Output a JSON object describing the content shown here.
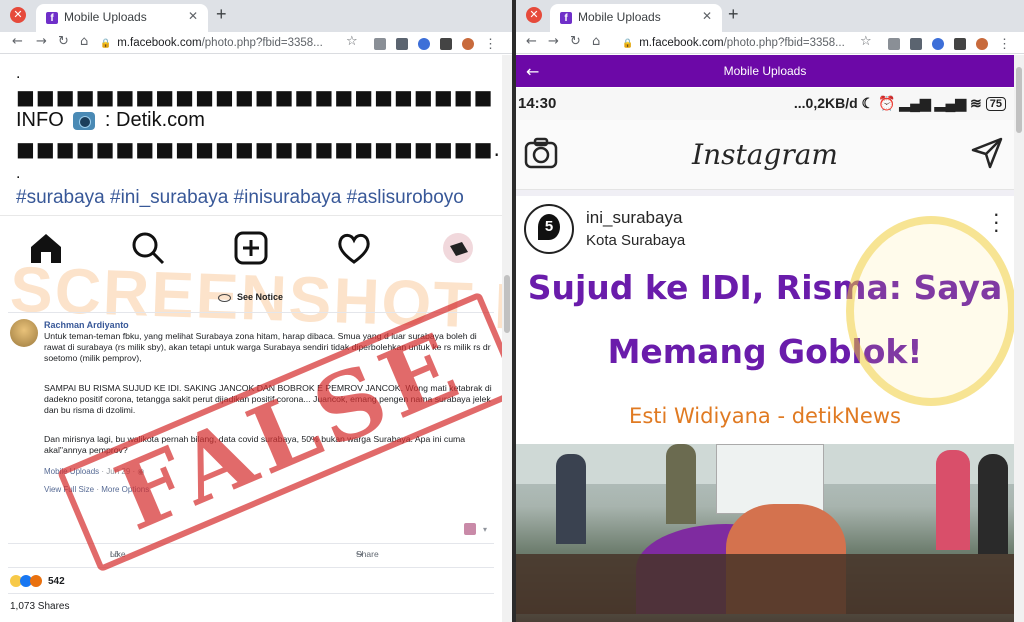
{
  "left_window": {
    "tab_title": "Mobile Uploads",
    "url_domain": "m.facebook.com",
    "url_path": "/photo.php?fbid=3358...",
    "post_image": {
      "dot1": ".",
      "blocks1": "■■■■■■■■■■■■■■■■■■■■■■■■",
      "info_prefix": "INFO",
      "info_suffix": ": Detik.com",
      "blocks2": "■■■■■■■■■■■■■■■■■■■■■■■■.",
      "dot2": ".",
      "hashtags": "#surabaya #ini_surabaya #inisurabaya #aslisuroboyo"
    },
    "see_notice": "See Notice",
    "comment": {
      "author": "Rachman Ardiyanto",
      "para1": "Untuk teman-teman fbku, yang melihat Surabaya zona hitam, harap dibaca. Smua yang d luar surabaya boleh di rawat di surabaya (rs milik sby), akan tetapi untuk warga Surabaya sendiri tidak diperbolehkan untuk ke rs milik rs dr soetomo (milik pemprov),",
      "para2": "SAMPAI BU RISMA SUJUD KE IDI. SAKING JANCOK DAN BOBROK E PEMROV JANCOK. Wong mati ketabrak di dadekno positif corona, tetangga sakit perut dijadikan positif corona... Juancok, emang pengen nama surabaya jelek dan bu risma di dzolimi.",
      "para3": "Dan mirisnya lagi, bu walikota pernah bilang, data covid surabaya, 50% bukan warga Surabaya. Apa ini cuma akal\"annya pemprov?",
      "album": "Mobile Uploads",
      "date": "Jun 29",
      "view_full": "View Full Size",
      "more_options": "More Options"
    },
    "like_label": "Like",
    "share_label": "Share",
    "reaction_count": "542",
    "shares_text": "1,073 Shares",
    "overlay": {
      "stamp": "FALSE",
      "watermark": "SCREENSHOT BY"
    }
  },
  "right_window": {
    "tab_title": "Mobile Uploads",
    "url_domain": "m.facebook.com",
    "url_path": "/photo.php?fbid=3358...",
    "header_title": "Mobile Uploads",
    "phone": {
      "time": "14:30",
      "status_right": "...0,2KB/d",
      "battery": "75",
      "ig_logo": "Instagram",
      "username": "ini_surabaya",
      "location": "Kota Surabaya",
      "headline1": "Sujud ke IDI, Risma: Saya",
      "headline2": "Memang Goblok!",
      "byline": "Esti Widiyana - detikNews"
    }
  },
  "colors": {
    "fb_purple": "#6c08a7",
    "headline_purple": "#6a1cab",
    "byline_orange": "#e07a22",
    "stamp_red": "#d63030",
    "link_blue": "#385898"
  }
}
